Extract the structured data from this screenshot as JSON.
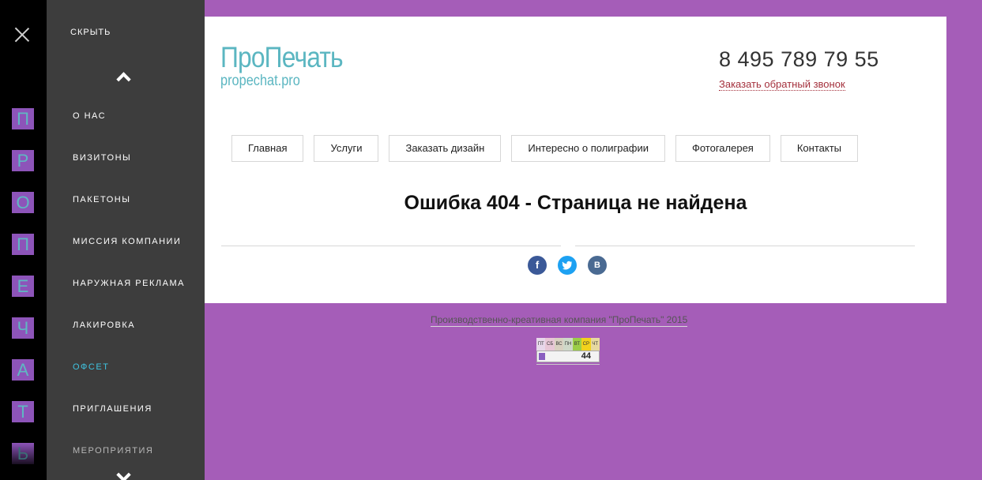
{
  "strip": {
    "letters": [
      "П",
      "Р",
      "О",
      "П",
      "Е",
      "Ч",
      "А",
      "Т",
      "Ь"
    ]
  },
  "menu": {
    "hide_label": "СКРЫТЬ",
    "items": [
      {
        "label": "О НАС"
      },
      {
        "label": "ВИЗИТОНЫ"
      },
      {
        "label": "ПАКЕТОНЫ"
      },
      {
        "label": "МИССИЯ КОМПАНИИ"
      },
      {
        "label": "НАРУЖНАЯ РЕКЛАМА"
      },
      {
        "label": "ЛАКИРОВКА"
      },
      {
        "label": "ОФСЕТ",
        "active": true
      },
      {
        "label": "ПРИГЛАШЕНИЯ"
      },
      {
        "label": "МЕРОПРИЯТИЯ"
      }
    ]
  },
  "header": {
    "logo_name": "ПроПечать",
    "logo_url": "propechat.pro",
    "phone": "8 495 789 79 55",
    "callback": "Заказать обратный звонок"
  },
  "nav": [
    "Главная",
    "Услуги",
    "Заказать дизайн",
    "Интересно о полиграфии",
    "Фотогалерея",
    "Контакты"
  ],
  "main": {
    "title": "Ошибка 404 - Страница не найдена"
  },
  "socials": [
    {
      "name": "facebook-icon",
      "glyph": "f"
    },
    {
      "name": "twitter-icon",
      "glyph": "🐦"
    },
    {
      "name": "vk-icon",
      "glyph": "В"
    }
  ],
  "footer": {
    "text": "Производственно-креативная компания \"ПроПечать\" 2015"
  },
  "counter": {
    "days": [
      "ПТ",
      "СБ",
      "ВС",
      "ПН",
      "ВТ",
      "СР",
      "ЧТ"
    ],
    "value": "44"
  },
  "colors": {
    "background": "#a55db8",
    "menu": "#3d3d3d",
    "brand": "#5bb6c1",
    "active_item": "#3fc3e0",
    "callback": "#a4303c"
  }
}
